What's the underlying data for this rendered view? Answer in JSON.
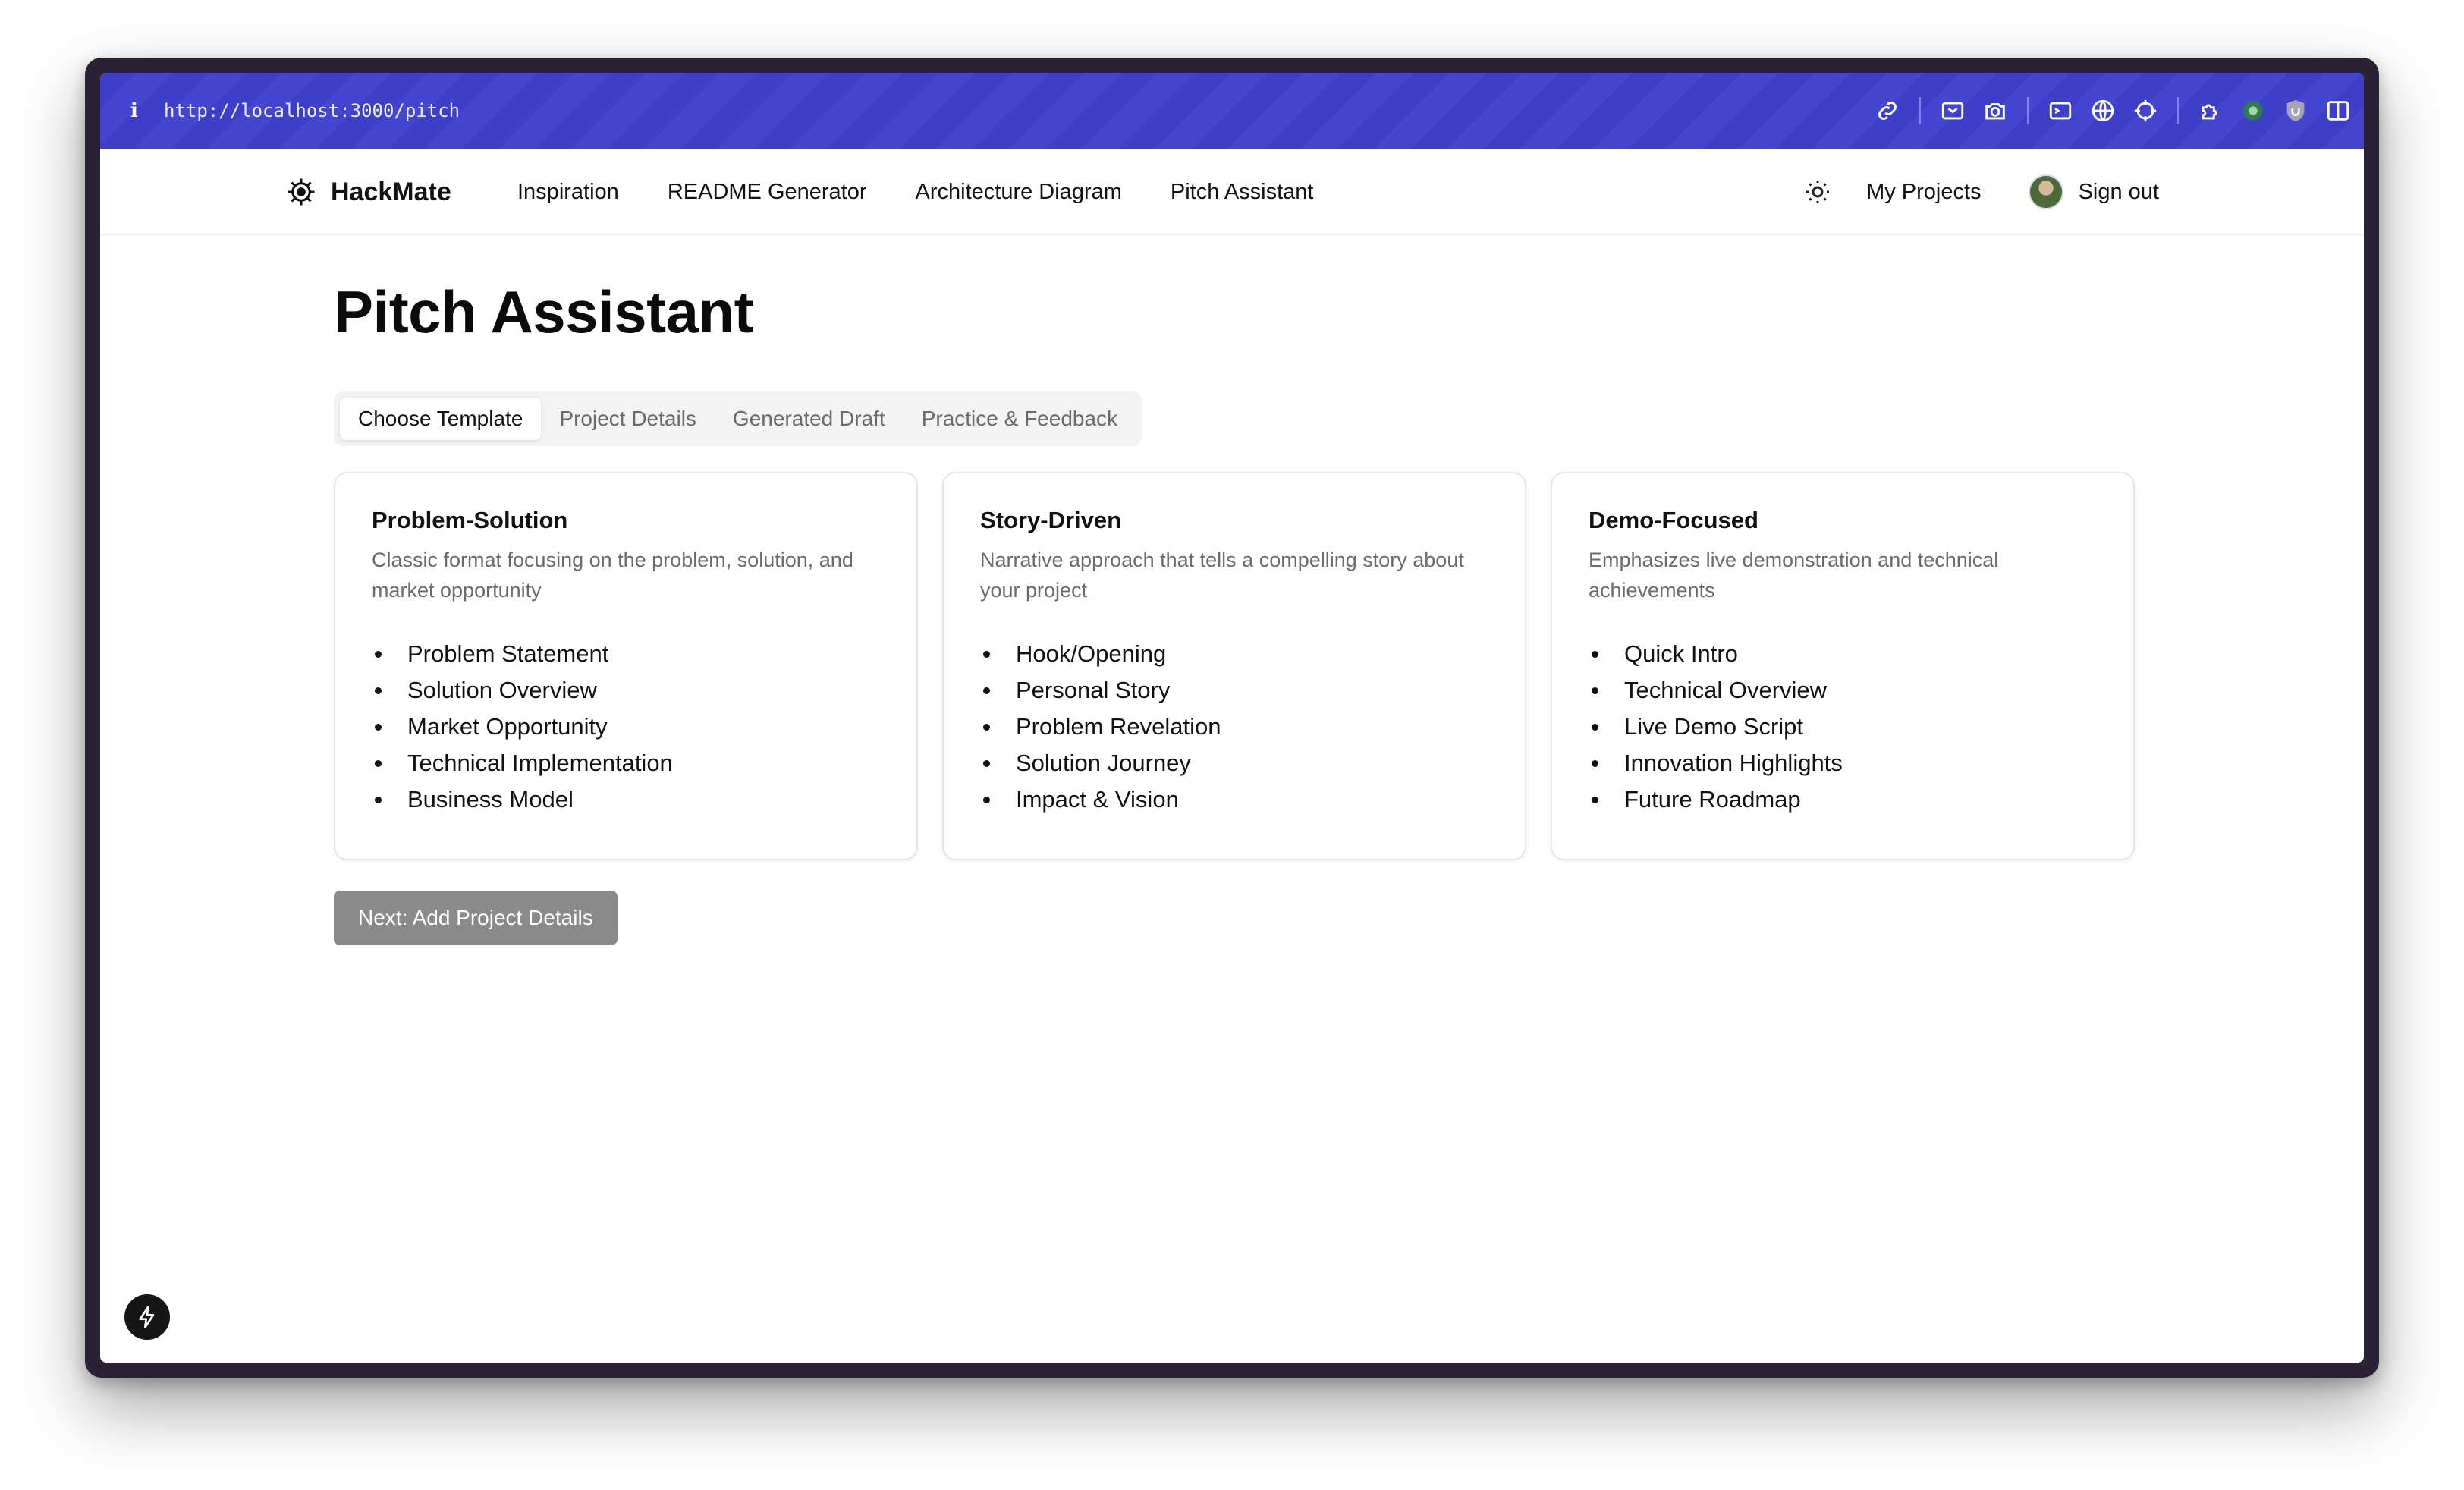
{
  "browser": {
    "info_glyph": "i",
    "url": "http://localhost:3000/pitch",
    "toolbar_icons": [
      "link-icon",
      "screenshot-icon",
      "camera-icon",
      "terminal-icon",
      "globe-icon",
      "crosshair-icon",
      "extension-icon",
      "extension-green-icon",
      "ublock-shield-icon",
      "sidebar-icon"
    ]
  },
  "nav": {
    "brand": "HackMate",
    "links": [
      "Inspiration",
      "README Generator",
      "Architecture Diagram",
      "Pitch Assistant"
    ],
    "my_projects": "My Projects",
    "sign_out": "Sign out"
  },
  "page": {
    "title": "Pitch Assistant",
    "tabs": [
      "Choose Template",
      "Project Details",
      "Generated Draft",
      "Practice & Feedback"
    ],
    "active_tab": "Choose Template",
    "templates": [
      {
        "name": "Problem-Solution",
        "description": "Classic format focusing on the problem, solution, and market opportunity",
        "sections": [
          "Problem Statement",
          "Solution Overview",
          "Market Opportunity",
          "Technical Implementation",
          "Business Model"
        ]
      },
      {
        "name": "Story-Driven",
        "description": "Narrative approach that tells a compelling story about your project",
        "sections": [
          "Hook/Opening",
          "Personal Story",
          "Problem Revelation",
          "Solution Journey",
          "Impact & Vision"
        ]
      },
      {
        "name": "Demo-Focused",
        "description": "Emphasizes live demonstration and technical achievements",
        "sections": [
          "Quick Intro",
          "Technical Overview",
          "Live Demo Script",
          "Innovation Highlights",
          "Future Roadmap"
        ]
      }
    ],
    "next_button": "Next: Add Project Details"
  },
  "colors": {
    "urlbar": "#4042cc",
    "button_disabled": "#8a8a8a",
    "frame": "#2a2234"
  }
}
